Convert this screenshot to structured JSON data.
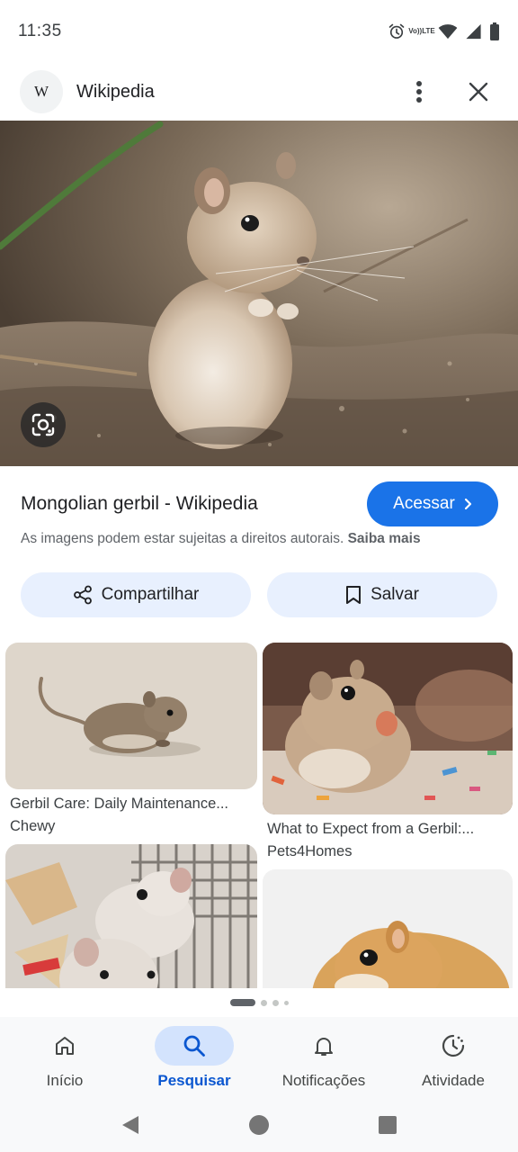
{
  "status_bar": {
    "time": "11:35",
    "volte_line1": "Vo))",
    "volte_line2": "LTE"
  },
  "header": {
    "logo_letter": "W",
    "site_name": "Wikipedia"
  },
  "result": {
    "title": "Mongolian gerbil - Wikipedia",
    "visit_label": "Acessar",
    "copyright_text": "As imagens podem estar sujeitas a direitos autorais.",
    "learn_more": "Saiba mais"
  },
  "actions": {
    "share_label": "Compartilhar",
    "save_label": "Salvar"
  },
  "related": [
    {
      "title": "Gerbil Care: Daily Maintenance...",
      "source": "Chewy"
    },
    {
      "title": "What to Expect from a Gerbil:...",
      "source": "Pets4Homes"
    },
    {
      "title": "",
      "source": ""
    },
    {
      "title": "",
      "source": ""
    }
  ],
  "bottom_nav": [
    {
      "label": "Início",
      "icon": "home-icon"
    },
    {
      "label": "Pesquisar",
      "icon": "search-icon"
    },
    {
      "label": "Notificações",
      "icon": "bell-icon"
    },
    {
      "label": "Atividade",
      "icon": "activity-icon"
    }
  ],
  "colors": {
    "accent": "#1a73e8",
    "tonal": "#e8f0fe",
    "nav_active": "#0b57d0"
  }
}
